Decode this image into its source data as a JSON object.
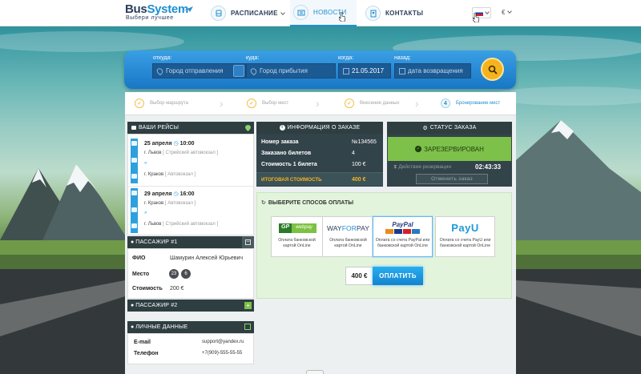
{
  "header": {
    "logo": {
      "brand_a": "Bus",
      "brand_b": "System",
      "tagline": "Выбери лучшее"
    },
    "nav": [
      {
        "label": "РАСПИСАНИЕ",
        "icon": "bus-icon",
        "dropdown": true
      },
      {
        "label": "НОВОСТИ",
        "icon": "news-icon",
        "active": true
      },
      {
        "label": "КОНТАКТЫ",
        "icon": "contacts-icon"
      }
    ],
    "currency": "€"
  },
  "search": {
    "from": {
      "label": "откуда:",
      "placeholder": "Город отправления"
    },
    "to": {
      "label": "куда:",
      "placeholder": "Город прибытия"
    },
    "date": {
      "label": "когда:",
      "value": "21.05.2017"
    },
    "back": {
      "label": "назад:",
      "placeholder": "дата возвращения"
    }
  },
  "steps": [
    {
      "label": "Выбор маршрута",
      "state": "done"
    },
    {
      "label": "Выбор мест",
      "state": "done"
    },
    {
      "label": "Внесение данных",
      "state": "done"
    },
    {
      "label": "Бронирование мест",
      "state": "current",
      "num": "4"
    }
  ],
  "trips": {
    "title": "ВАШИ РЕЙСЫ",
    "items": [
      {
        "date": "25 апреля",
        "time": "10:00",
        "from_city": "г. Львов",
        "from_station": "[ Стрийский автовокзал ]",
        "to_city": "г. Краков",
        "to_station": "[ Автовокзал ]"
      },
      {
        "date": "29 апреля",
        "time": "16:00",
        "from_city": "г. Краков",
        "from_station": "[ Автовокзал ]",
        "to_city": "г. Львов",
        "to_station": "[ Стрийский автовокзал ]"
      }
    ]
  },
  "passenger1": {
    "title": "ПАССАЖИР #1",
    "fio_label": "ФИО",
    "fio": "Шамурин Алексей Юрьевич",
    "seat_label": "Место",
    "seats": [
      "23",
      "6"
    ],
    "price_label": "Стоимость",
    "price": "200 €"
  },
  "passenger2": {
    "title": "ПАССАЖИР #2"
  },
  "personal": {
    "title": "ЛИЧНЫЕ ДАННЫЕ",
    "email_label": "E-mail",
    "email": "support@yandex.ru",
    "phone_label": "Телефон",
    "phone": "+7(909)-555-55-55"
  },
  "order": {
    "title": "ИНФОРМАЦИЯ О ЗАКАЗЕ",
    "rows": [
      {
        "label": "Номер заказа",
        "value": "№134565"
      },
      {
        "label": "Заказано билетов",
        "value": "4"
      },
      {
        "label": "Стоимость 1 билета",
        "value": "100 €"
      }
    ],
    "total_label": "ИТОГОВАЯ СТОИМОСТЬ",
    "total": "400 €"
  },
  "status": {
    "title": "СТАТУС ЗАКАЗА",
    "state": "ЗАРЕЗЕРВИРОВАН",
    "timer_label": "Действие резервации",
    "timer": "02:43:33",
    "cancel": "Отменить заказ"
  },
  "payment": {
    "title": "ВЫБЕРИТЕ СПОСОБ ОПЛАТЫ",
    "methods": [
      {
        "logo_a": "GP",
        "logo_b": "webpay",
        "caption": "Оплата банковской картой OnLine"
      },
      {
        "logo_a": "WAY",
        "logo_b": "FOR",
        "logo_c": "PAY",
        "caption": "Оплата банковской картой OnLine"
      },
      {
        "logo_a": "PayPal",
        "caption": "Оплата со счета PayPal или банковской картой OnLine"
      },
      {
        "logo_a": "PayU",
        "caption": "Оплата со счета PayU или банковской картой OnLine"
      }
    ],
    "amount": "400 €",
    "pay_button": "ОПЛАТИТЬ"
  },
  "colors": {
    "accent": "#1e8fcf",
    "dark": "#2e3e41",
    "green": "#7dc04a",
    "orange": "#f6b31d"
  }
}
